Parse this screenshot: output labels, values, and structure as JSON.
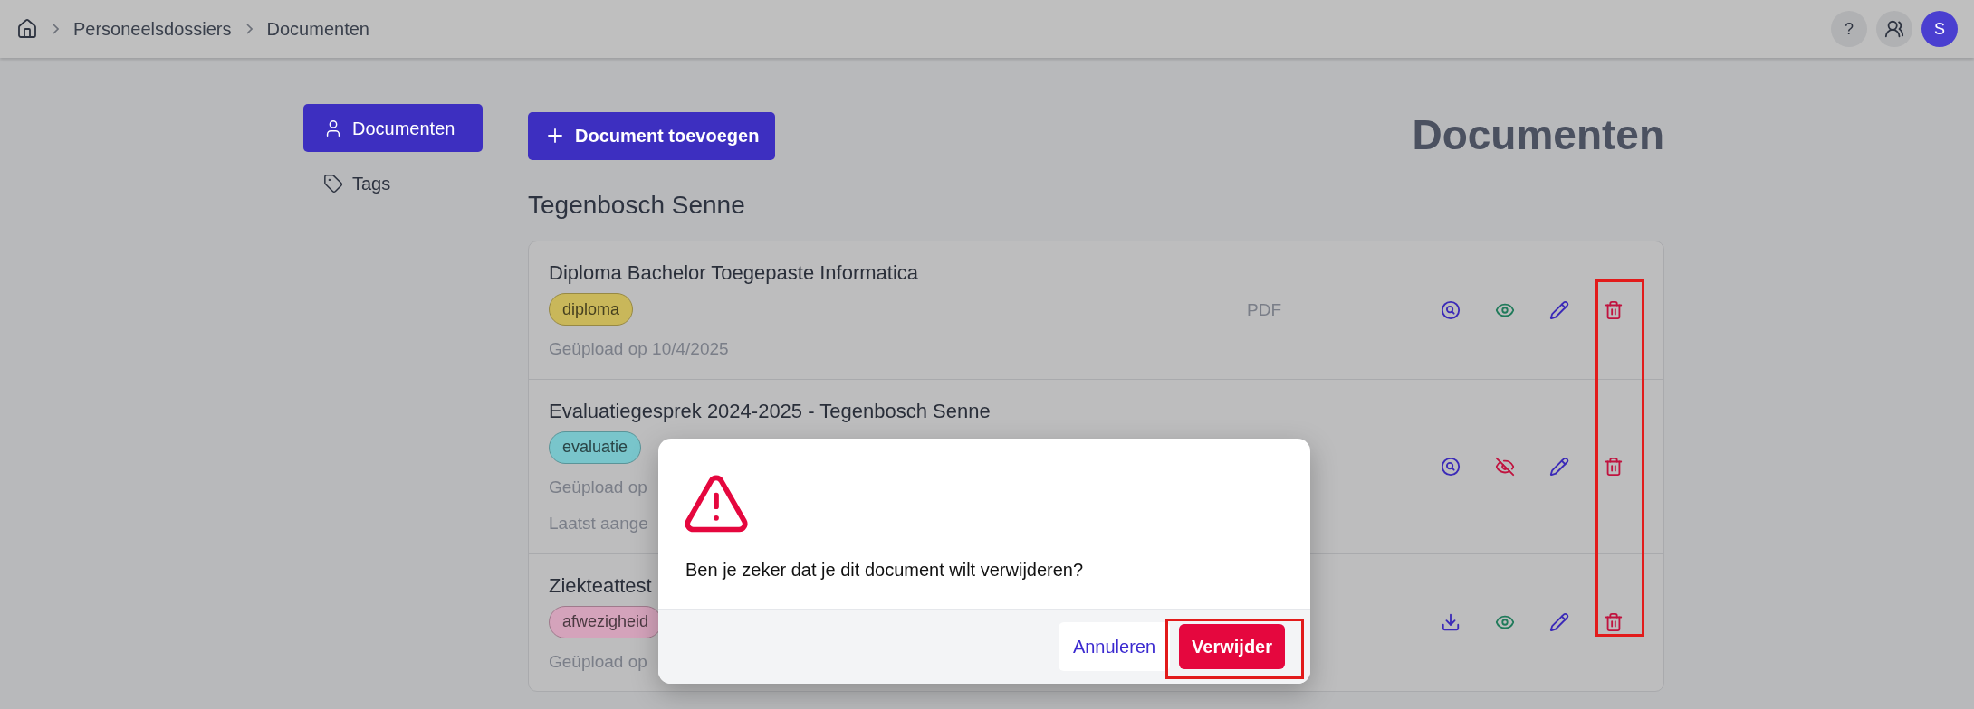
{
  "breadcrumb": [
    "Personeelsdossiers",
    "Documenten"
  ],
  "header_actions": {
    "help": "?",
    "avatar": "S"
  },
  "sidebar": {
    "items": [
      {
        "label": "Documenten",
        "kind": "user",
        "selected": true
      },
      {
        "label": "Tags",
        "kind": "tag",
        "selected": false
      }
    ]
  },
  "add_button": "Document toevoegen",
  "page_title": "Documenten",
  "person": "Tegenbosch Senne",
  "documents": [
    {
      "title": "Diploma Bachelor Toegepaste Informatica",
      "tag": {
        "label": "diploma",
        "color": "#c9b75a"
      },
      "format": "PDF",
      "lines": [
        "Geüpload op 10/4/2025"
      ],
      "kind": "preview",
      "visible": true
    },
    {
      "title": "Evaluatiegesprek 2024-2025 - Tegenbosch Senne",
      "tag": {
        "label": "evaluatie",
        "color": "#79c5cb"
      },
      "lines": [
        "Geüpload op",
        "Laatst aange"
      ],
      "kind": "preview",
      "visible": false
    },
    {
      "title": "Ziekteattest",
      "tag": {
        "label": "afwezigheid",
        "color": "#d4a3bb"
      },
      "lines": [
        "Geüpload op"
      ],
      "kind": "download",
      "visible": true
    }
  ],
  "dialog": {
    "message": "Ben je zeker dat je dit document wilt verwijderen?",
    "cancel": "Annuleren",
    "confirm": "Verwijder"
  }
}
